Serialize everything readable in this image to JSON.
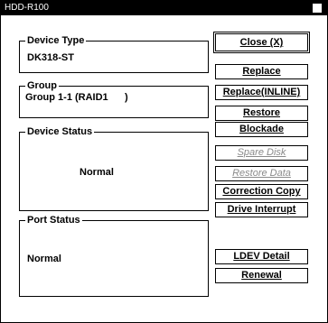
{
  "window": {
    "title": "HDD-R100"
  },
  "groups": {
    "device_type": {
      "label": "Device Type",
      "value": "DK318-ST"
    },
    "group": {
      "label": "Group",
      "value": "Group 1-1 (RAID1      )"
    },
    "device_status": {
      "label": "Device Status",
      "value": "Normal"
    },
    "port_status": {
      "label": "Port Status",
      "value": "Normal"
    }
  },
  "buttons": {
    "close": "Close (X)",
    "replace": "Replace",
    "replace_inline": "Replace(INLINE)",
    "restore": "Restore",
    "blockade": "Blockade",
    "spare_disk": "Spare Disk",
    "restore_data": "Restore Data",
    "correction_copy": "Correction Copy",
    "drive_interrupt": "Drive Interrupt",
    "ldev_detail": "LDEV Detail",
    "renewal": "Renewal"
  }
}
